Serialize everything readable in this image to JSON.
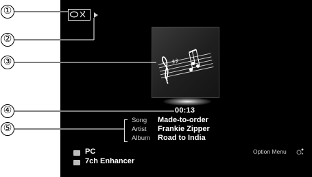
{
  "callouts": [
    "①",
    "②",
    "③",
    "④",
    "⑤"
  ],
  "player": {
    "elapsed_time": "00:13",
    "repeat_mode": "repeat-off-icon",
    "playback_state": "play-icon"
  },
  "metadata": {
    "song_label": "Song",
    "song": "Made-to-order",
    "artist_label": "Artist",
    "artist": "Frankie Zipper",
    "album_label": "Album",
    "album": "Road to India"
  },
  "footer": {
    "input_source": "PC",
    "dsp_program": "7ch Enhancer",
    "option_menu_label": "Option Menu"
  },
  "colors": {
    "screen_background": "#000000",
    "text_primary": "#ffffff",
    "text_secondary": "#d8d8d8"
  }
}
